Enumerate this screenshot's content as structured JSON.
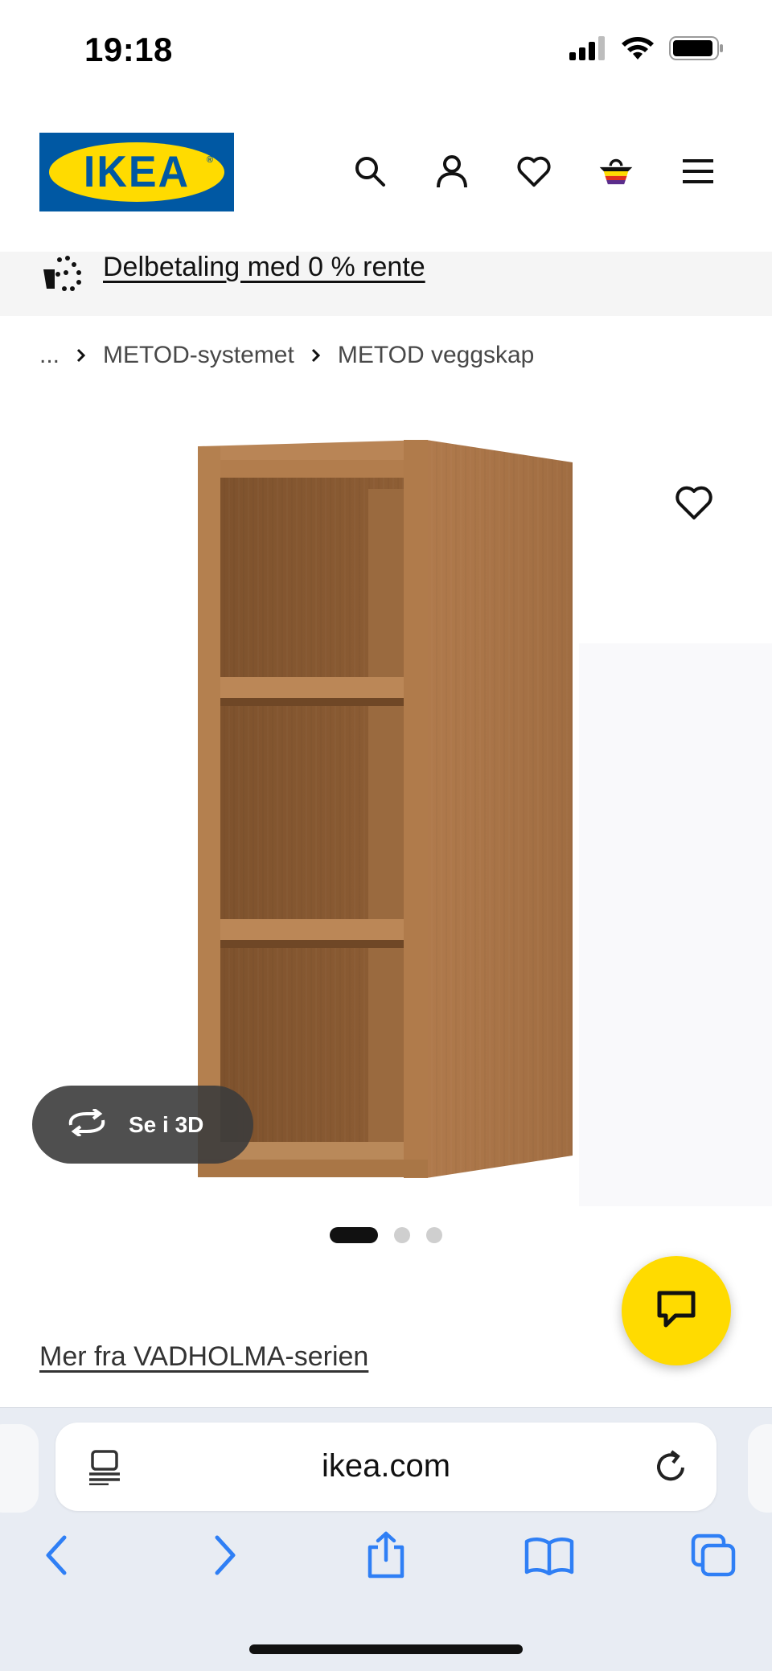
{
  "status_bar": {
    "time": "19:18",
    "icons": [
      "cellular-signal-icon",
      "wifi-icon",
      "battery-icon"
    ]
  },
  "header": {
    "logo_text": "IKEA",
    "icons": [
      "search-icon",
      "account-icon",
      "heart-icon",
      "shopping-bag-icon",
      "menu-icon"
    ]
  },
  "promo": {
    "text": "Delbetaling med 0 % rente",
    "icon": "installment-payment-icon"
  },
  "breadcrumb": {
    "items": [
      "...",
      "METOD-systemet",
      "METOD veggskap"
    ]
  },
  "product": {
    "see_3d_label": "Se i 3D",
    "favorite_icon": "heart-icon",
    "carousel": {
      "total": 3,
      "active": 1
    }
  },
  "series_link": "Mer fra VADHOLMA-serien",
  "chat_icon": "chat-bubble-icon",
  "browser": {
    "url": "ikea.com",
    "icons": [
      "reader-mode-icon",
      "reload-icon",
      "back-icon",
      "forward-icon",
      "share-icon",
      "bookmarks-icon",
      "tabs-icon"
    ]
  },
  "colors": {
    "ikea_blue": "#0058a3",
    "ikea_yellow": "#ffdb00",
    "safari_blue": "#2f7ff5"
  }
}
